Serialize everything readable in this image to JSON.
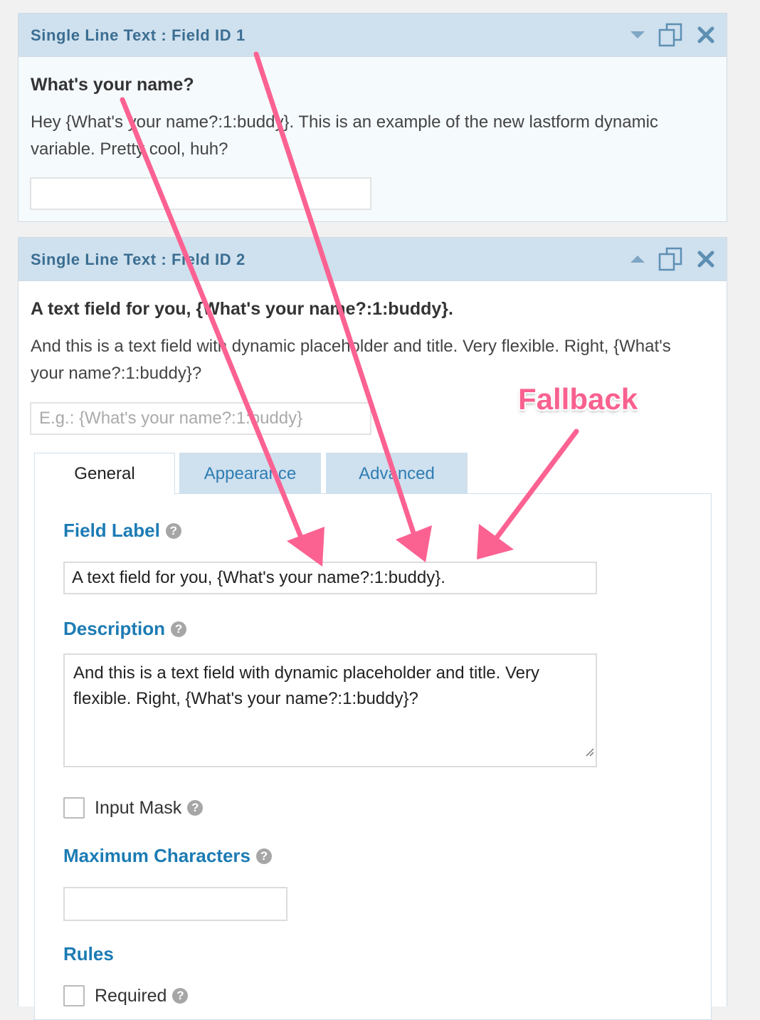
{
  "colors": {
    "header_bg": "#cfe0ee",
    "header_text": "#3b6e92",
    "label_blue": "#1c7bb4",
    "annotation_pink": "#f9618f"
  },
  "panel1": {
    "header": "Single Line Text : Field ID 1",
    "title": "What's your name?",
    "description": "Hey {What's your name?:1:buddy}. This is an example of the new lastform dynamic variable. Pretty cool, huh?",
    "input_value": "",
    "icons": [
      "caret-down-icon",
      "duplicate-icon",
      "close-icon"
    ]
  },
  "panel2": {
    "header": "Single Line Text : Field ID 2",
    "title": "A text field for you, {What's your name?:1:buddy}.",
    "description": "And this is a text field with dynamic placeholder and title. Very flexible. Right, {What's your name?:1:buddy}?",
    "placeholder": "E.g.: {What's your name?:1:buddy}",
    "icons": [
      "caret-up-icon",
      "duplicate-icon",
      "close-icon"
    ],
    "tabs": [
      {
        "label": "General",
        "active": true
      },
      {
        "label": "Appearance",
        "active": false
      },
      {
        "label": "Advanced",
        "active": false
      }
    ],
    "settings": {
      "field_label_heading": "Field Label",
      "field_label_value": "A text field for you, {What's your name?:1:buddy}.",
      "description_heading": "Description",
      "description_value": "And this is a text field with dynamic placeholder and title. Very flexible. Right, {What's your name?:1:buddy}?",
      "input_mask_label": "Input Mask",
      "input_mask_checked": false,
      "max_chars_heading": "Maximum Characters",
      "max_chars_value": "",
      "rules_heading": "Rules",
      "required_label": "Required",
      "required_checked": false
    }
  },
  "annotation": {
    "text": "Fallback",
    "help_glyph": "?"
  }
}
